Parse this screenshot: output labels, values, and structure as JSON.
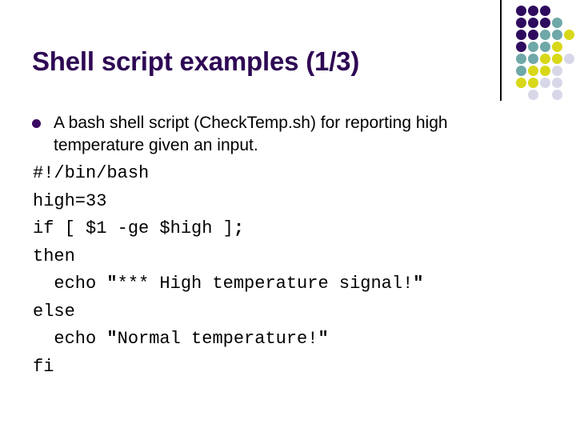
{
  "slide": {
    "title": "Shell script examples (1/3)",
    "accent_color": "#2E0854",
    "background_color": "#FFFFFF"
  },
  "bullets": [
    {
      "marker": "disc",
      "text": "A bash shell script (CheckTemp.sh) for reporting high temperature given an input."
    }
  ],
  "code": {
    "language": "bash",
    "lines": [
      "#!/bin/bash",
      "high=33",
      "if [ $1 -ge $high ];",
      "then",
      "  echo \"*** High temperature signal!\"",
      "else",
      "  echo \"Normal temperature!\"",
      "fi"
    ]
  },
  "decor": {
    "palette": {
      "dark_purple": "#2E0B5E",
      "teal": "#6FA8A8",
      "yellow": "#D8D818",
      "pale": "#D7D7E8"
    },
    "dot_pitch": 15,
    "dot_size": 13,
    "grid": [
      [
        "dark_purple",
        "dark_purple",
        "dark_purple",
        "none",
        "none"
      ],
      [
        "dark_purple",
        "dark_purple",
        "dark_purple",
        "teal",
        "none"
      ],
      [
        "dark_purple",
        "dark_purple",
        "teal",
        "teal",
        "yellow"
      ],
      [
        "dark_purple",
        "teal",
        "teal",
        "yellow",
        "none"
      ],
      [
        "teal",
        "teal",
        "yellow",
        "yellow",
        "pale"
      ],
      [
        "teal",
        "yellow",
        "yellow",
        "pale",
        "none"
      ],
      [
        "yellow",
        "yellow",
        "pale",
        "pale",
        "none"
      ],
      [
        "none",
        "pale",
        "none",
        "pale",
        "none"
      ]
    ],
    "rule_color": "#000000"
  }
}
